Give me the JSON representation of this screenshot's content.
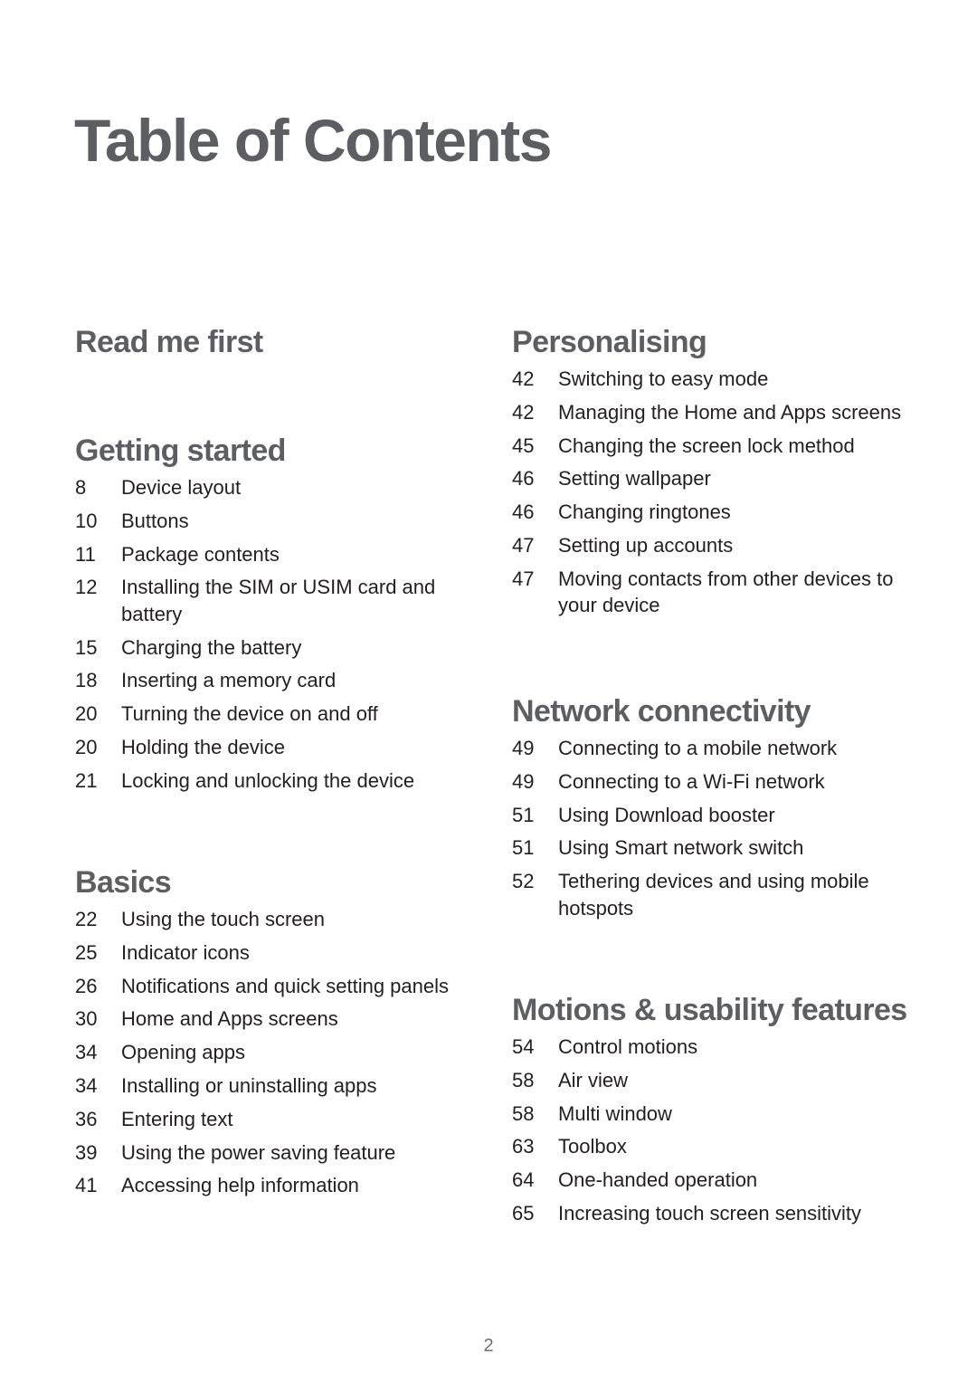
{
  "page": {
    "title": "Table of Contents",
    "page_number": "2"
  },
  "colors": {
    "heading": "#5d5e61",
    "entry_text": "#231f20",
    "page_number": "#6d6e71"
  },
  "left_column": {
    "sections": [
      {
        "heading": "Read me first",
        "entries": []
      },
      {
        "heading": "Getting started",
        "entries": [
          {
            "page": "8",
            "title": "Device layout"
          },
          {
            "page": "10",
            "title": "Buttons"
          },
          {
            "page": "11",
            "title": "Package contents"
          },
          {
            "page": "12",
            "title": "Installing the SIM or USIM card and battery"
          },
          {
            "page": "15",
            "title": "Charging the battery"
          },
          {
            "page": "18",
            "title": "Inserting a memory card"
          },
          {
            "page": "20",
            "title": "Turning the device on and off"
          },
          {
            "page": "20",
            "title": "Holding the device"
          },
          {
            "page": "21",
            "title": "Locking and unlocking the device"
          }
        ]
      },
      {
        "heading": "Basics",
        "entries": [
          {
            "page": "22",
            "title": "Using the touch screen"
          },
          {
            "page": "25",
            "title": "Indicator icons"
          },
          {
            "page": "26",
            "title": "Notifications and quick setting panels"
          },
          {
            "page": "30",
            "title": "Home and Apps screens"
          },
          {
            "page": "34",
            "title": "Opening apps"
          },
          {
            "page": "34",
            "title": "Installing or uninstalling apps"
          },
          {
            "page": "36",
            "title": "Entering text"
          },
          {
            "page": "39",
            "title": "Using the power saving feature"
          },
          {
            "page": "41",
            "title": "Accessing help information"
          }
        ]
      }
    ]
  },
  "right_column": {
    "sections": [
      {
        "heading": "Personalising",
        "entries": [
          {
            "page": "42",
            "title": "Switching to easy mode"
          },
          {
            "page": "42",
            "title": "Managing the Home and Apps screens"
          },
          {
            "page": "45",
            "title": "Changing the screen lock method"
          },
          {
            "page": "46",
            "title": "Setting wallpaper"
          },
          {
            "page": "46",
            "title": "Changing ringtones"
          },
          {
            "page": "47",
            "title": "Setting up accounts"
          },
          {
            "page": "47",
            "title": "Moving contacts from other devices to your device"
          }
        ]
      },
      {
        "heading": "Network connectivity",
        "entries": [
          {
            "page": "49",
            "title": "Connecting to a mobile network"
          },
          {
            "page": "49",
            "title": "Connecting to a Wi-Fi network"
          },
          {
            "page": "51",
            "title": "Using Download booster"
          },
          {
            "page": "51",
            "title": "Using Smart network switch"
          },
          {
            "page": "52",
            "title": "Tethering devices and using mobile hotspots"
          }
        ]
      },
      {
        "heading": "Motions & usability features",
        "entries": [
          {
            "page": "54",
            "title": "Control motions"
          },
          {
            "page": "58",
            "title": "Air view"
          },
          {
            "page": "58",
            "title": "Multi window"
          },
          {
            "page": "63",
            "title": "Toolbox"
          },
          {
            "page": "64",
            "title": "One-handed operation"
          },
          {
            "page": "65",
            "title": "Increasing touch screen sensitivity"
          }
        ]
      }
    ]
  }
}
